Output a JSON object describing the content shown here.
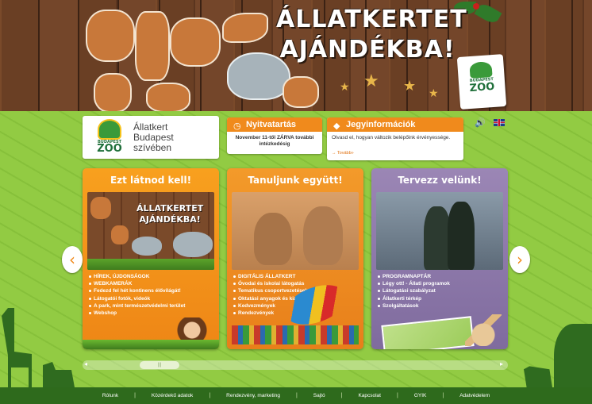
{
  "hero": {
    "title_line1": "ÁLLATKERTET",
    "title_line2": "AJÁNDÉKBA!",
    "logo_line1": "BUDAPEST",
    "logo_line2": "ZOO"
  },
  "logo_box": {
    "logo_line1": "BUDAPEST",
    "logo_line2": "ZOO",
    "tagline_1": "Állatkert",
    "tagline_2": "Budapest",
    "tagline_3": "szívében"
  },
  "opening_hours": {
    "title": "Nyitvatartás",
    "icon": "clock-icon",
    "text": "November 11-től ZÁRVA további intézkedésig"
  },
  "ticket_info": {
    "title": "Jegyinformációk",
    "icon": "ticket-icon",
    "text": "Olvasd el, hogyan változik belépőink érvényessége.",
    "more": "→ Tovább»"
  },
  "language": {
    "sound_icon": "speaker-icon",
    "flag_icon": "uk-flag-icon"
  },
  "columns": [
    {
      "title": "Ezt látnod kell!",
      "image_text_1": "ÁLLATKERTET",
      "image_text_2": "AJÁNDÉKBA!",
      "items": [
        "HÍREK, ÚJDONSÁGOK",
        "WEBKAMERÁK",
        "Fedezd fel hét kontinens élővilágát!",
        "Látogatói fotók, videók",
        "A park, mint természetvédelmi terület",
        "Webshop"
      ]
    },
    {
      "title": "Tanuljunk együtt!",
      "items": [
        "DIGITÁLIS ÁLLATKERT",
        "Óvodai és iskolai látogatás",
        "Tematikus csoportvezetések",
        "Oktatási anyagok és kiadványok",
        "Kedvezmények",
        "Rendezvények"
      ]
    },
    {
      "title": "Tervezz velünk!",
      "items": [
        "PROGRAMNAPTÁR",
        "Légy ott! - Állati programok",
        "Látogatási szabályzat",
        "Állatkerti térkép",
        "Szolgáltatások"
      ]
    }
  ],
  "scroll": {
    "thumb_label": "|||"
  },
  "footer": {
    "links": [
      "Rólunk",
      "Közérdekű adatok",
      "Rendezvény, marketing",
      "Sajtó",
      "Kapcsolat",
      "GYIK",
      "Adatvédelem"
    ]
  },
  "colors": {
    "orange": "#f08a1c",
    "purple": "#8a76a8",
    "green": "#8cc63e",
    "dark_green": "#2e6a1c"
  }
}
